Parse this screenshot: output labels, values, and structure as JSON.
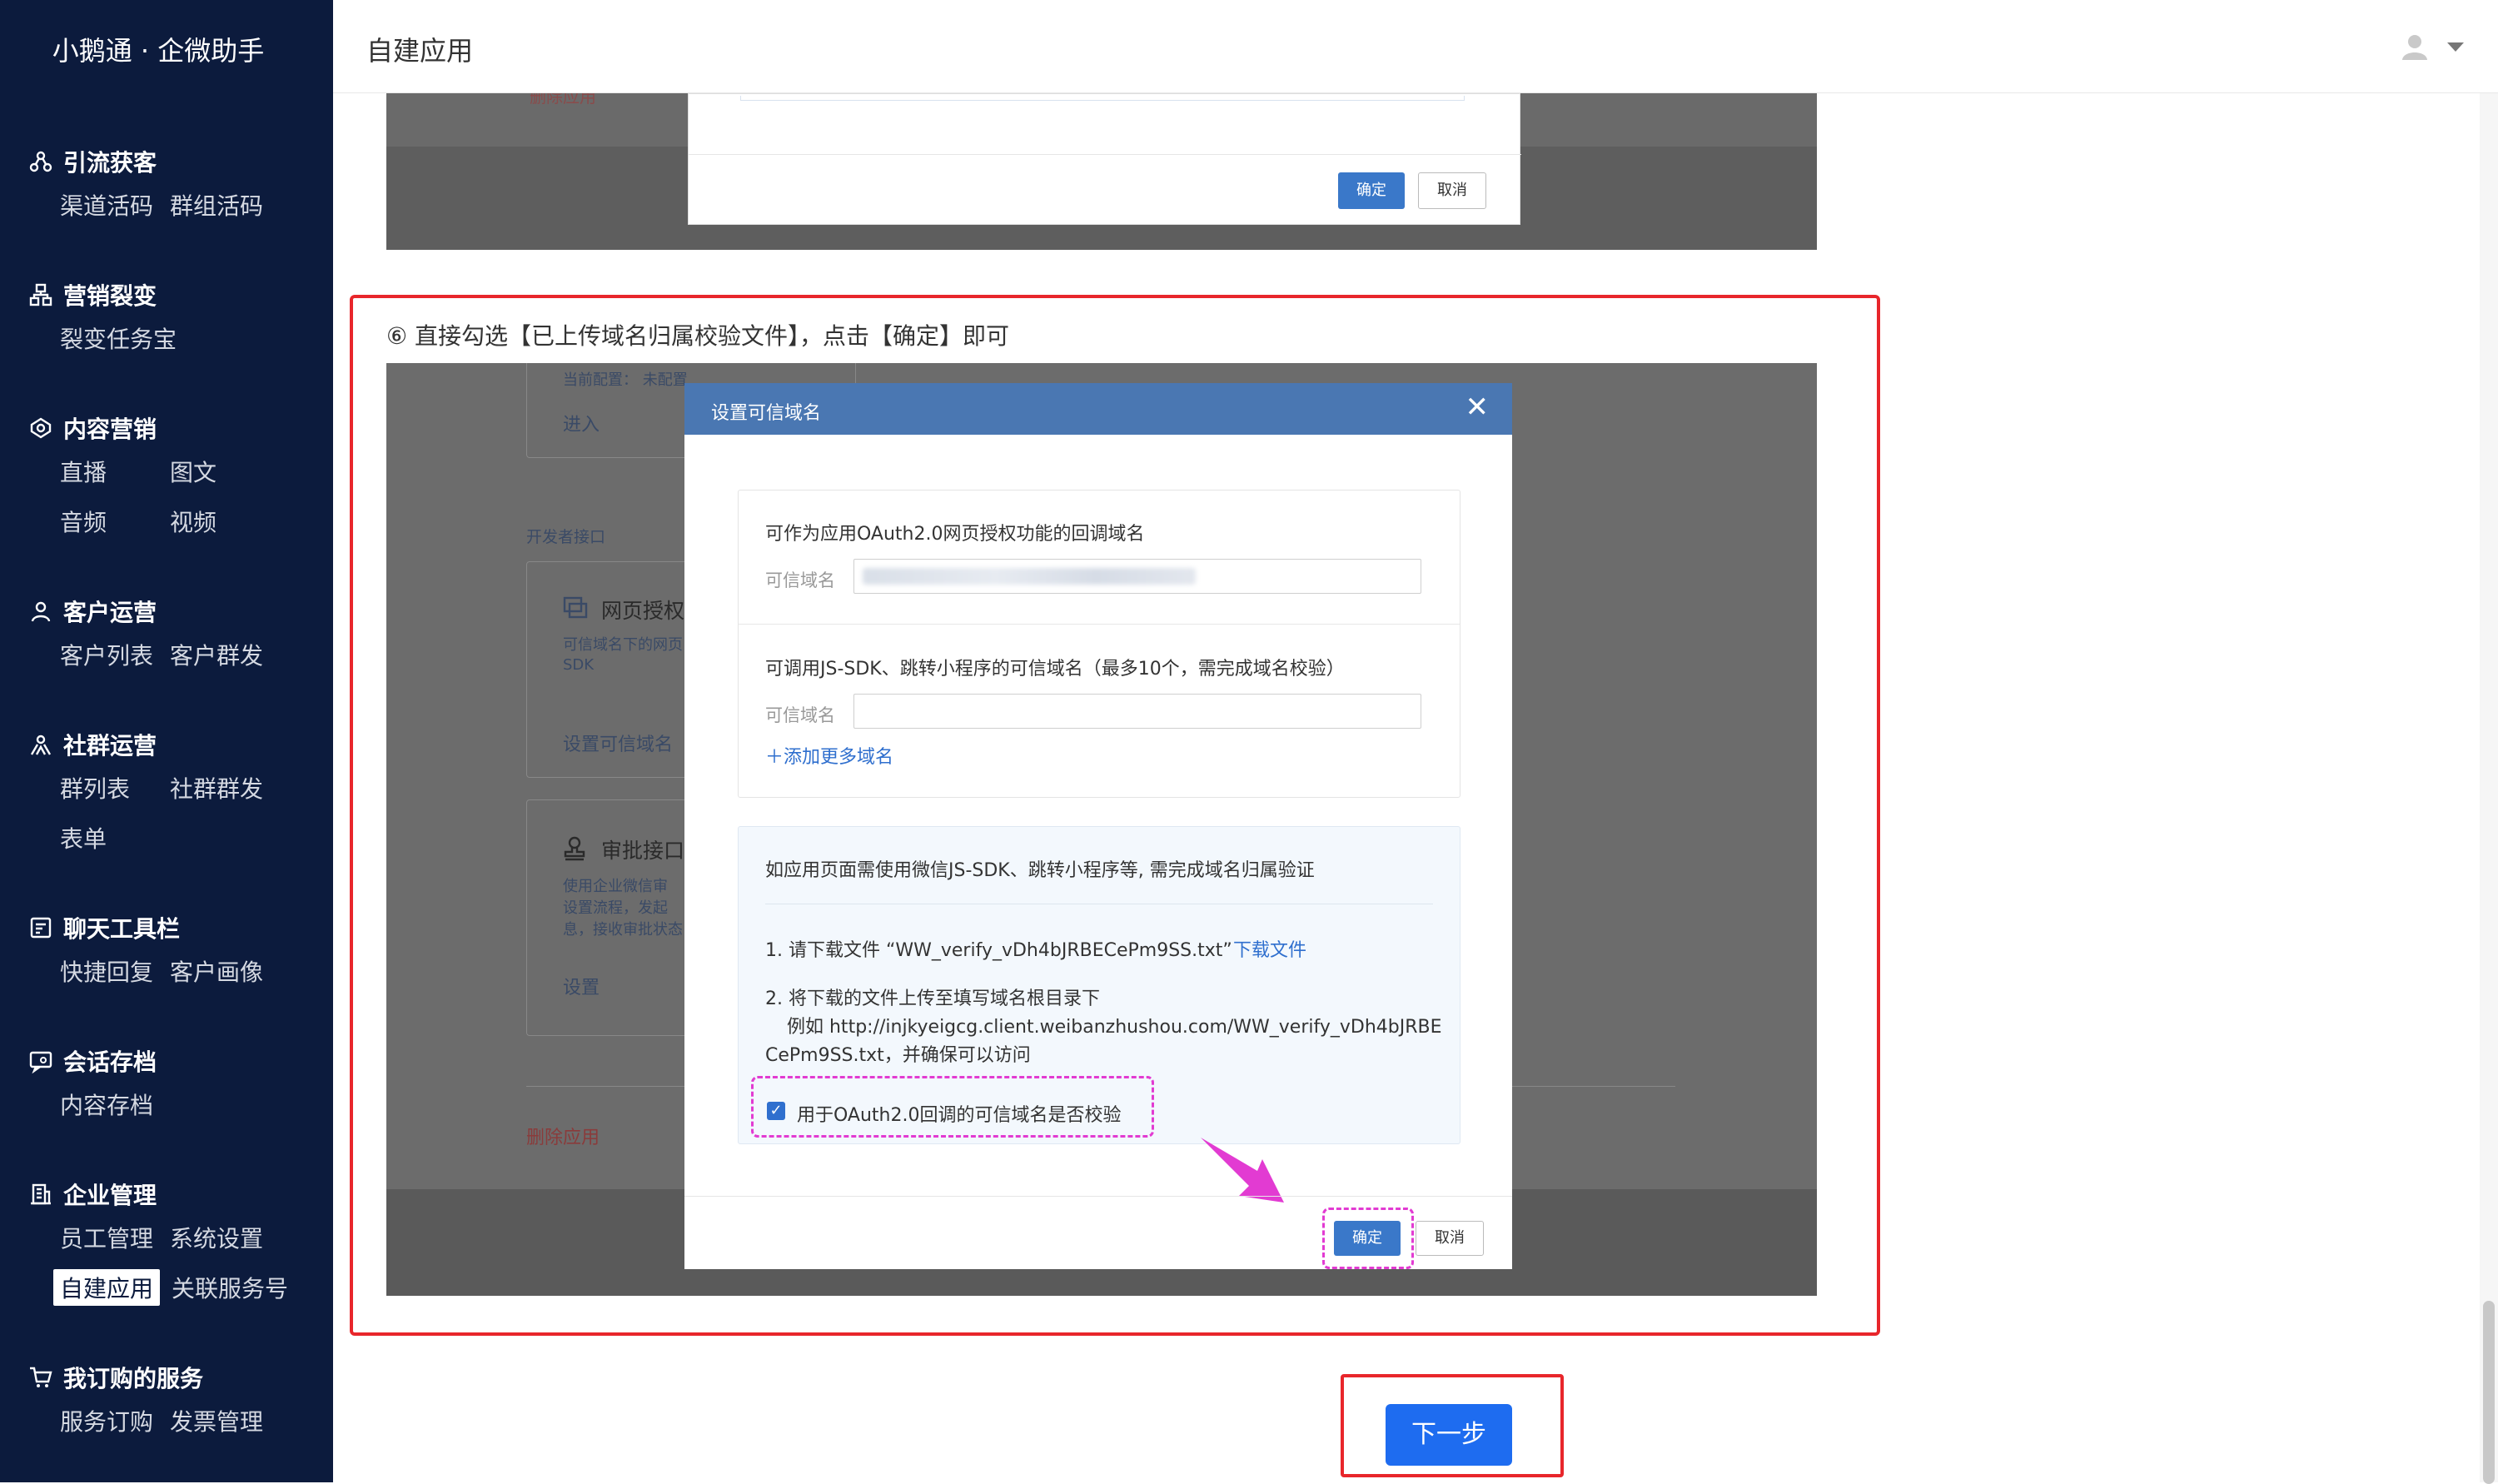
{
  "app": {
    "brand": "小鹅通 · 企微助手"
  },
  "header": {
    "title": "自建应用"
  },
  "sidebar": {
    "sections": [
      {
        "icon": "nodes-icon",
        "title": "引流获客",
        "items": [
          "渠道活码",
          "群组活码"
        ]
      },
      {
        "icon": "org-chart-icon",
        "title": "营销裂变",
        "items": [
          "裂变任务宝"
        ]
      },
      {
        "icon": "broadcast-icon",
        "title": "内容营销",
        "items": [
          "直播",
          "图文",
          "音频",
          "视频"
        ]
      },
      {
        "icon": "person-icon",
        "title": "客户运营",
        "items": [
          "客户列表",
          "客户群发"
        ]
      },
      {
        "icon": "group-icon",
        "title": "社群运营",
        "items": [
          "群列表",
          "社群群发",
          "表单"
        ]
      },
      {
        "icon": "toolbar-icon",
        "title": "聊天工具栏",
        "items": [
          "快捷回复",
          "客户画像"
        ]
      },
      {
        "icon": "chat-archive-icon",
        "title": "会话存档",
        "items": [
          "内容存档"
        ]
      },
      {
        "icon": "building-icon",
        "title": "企业管理",
        "items": [
          "员工管理",
          "系统设置",
          "自建应用",
          "关联服务号"
        ]
      },
      {
        "icon": "cart-icon",
        "title": "我订购的服务",
        "items": [
          "服务订购",
          "发票管理"
        ]
      }
    ],
    "active_item": "自建应用"
  },
  "top_screenshot": {
    "confirm": "确定",
    "cancel": "取消",
    "bg_link": "删除应用"
  },
  "step": {
    "text": "⑥ 直接勾选【已上传域名归属校验文件】，点击【确定】即可"
  },
  "background_page": {
    "current_config": "当前配置：  未配置",
    "enter": "进入",
    "dev_api": "开发者接口",
    "web_auth": "网页授权",
    "web_auth_desc1": "可信域名下的网页",
    "web_auth_desc2": "SDK",
    "set_domain": "设置可信域名",
    "approval": "审批接口",
    "approval_desc1": "使用企业微信审",
    "approval_desc2": "设置流程，发起",
    "approval_desc3": "息，接收审批状态",
    "setting": "设置",
    "delete_app": "删除应用"
  },
  "dialog": {
    "title": "设置可信域名",
    "close": "✕",
    "section1_title": "可作为应用OAuth2.0网页授权功能的回调域名",
    "field_label": "可信域名",
    "section2_title": "可调用JS-SDK、跳转小程序的可信域名（最多10个，需完成域名校验）",
    "add_more": "＋添加更多域名",
    "verify_title": "如应用页面需使用微信JS-SDK、跳转小程序等, 需完成域名归属验证",
    "step1_prefix": "1. 请下载文件 “WW_verify_vDh4bJRBECePm9SS.txt”",
    "download_link": "下载文件",
    "step2_line1": "2. 将下载的文件上传至填写域名根目录下",
    "step2_line2": "例如 http://injkyeigcg.client.weibanzhushou.com/WW_verify_vDh4bJRBE",
    "step2_line3": "CePm9SS.txt，并确保可以访问",
    "checkbox_label": "用于OAuth2.0回调的可信域名是否校验",
    "checkbox_checked": true,
    "confirm": "确定",
    "cancel": "取消"
  },
  "next_button": "下一步",
  "colors": {
    "sidebar_bg": "#0c1b3d",
    "highlight_red": "#e8262b",
    "annotation_pink": "#e23bd2",
    "primary_blue": "#1e6cf0"
  }
}
